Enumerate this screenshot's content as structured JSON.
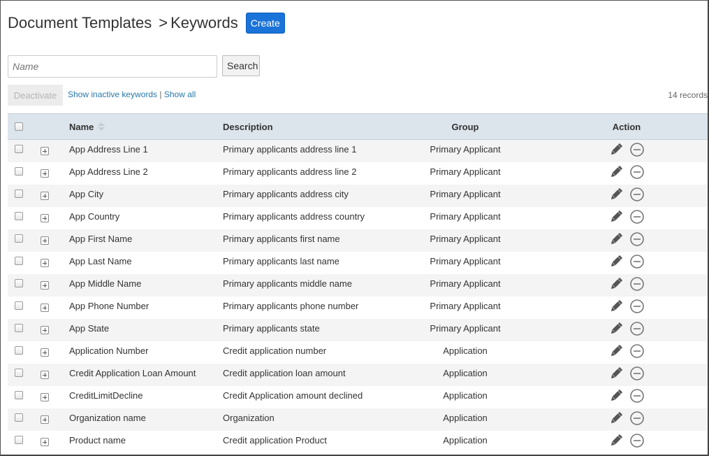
{
  "header": {
    "title": "Document Templates",
    "separator": ">",
    "current": "Keywords",
    "create_label": "Create"
  },
  "search": {
    "placeholder": "Name",
    "value": "",
    "button_label": "Search"
  },
  "toolbar": {
    "deactivate_label": "Deactivate",
    "show_inactive_label": "Show inactive keywords",
    "divider": "|",
    "show_all_label": "Show all",
    "records_count": "14 records"
  },
  "table": {
    "columns": [
      "Name",
      "Description",
      "Group",
      "Action"
    ],
    "sort_icon": "sort-both-icon",
    "row_icons": [
      "expand-plus-icon",
      "pencil-edit-icon",
      "minus-circle-icon"
    ],
    "rows": [
      {
        "name": "App Address Line 1",
        "description": "Primary applicants address line 1",
        "group": "Primary Applicant"
      },
      {
        "name": "App Address Line 2",
        "description": "Primary applicants address line 2",
        "group": "Primary Applicant"
      },
      {
        "name": "App City",
        "description": "Primary applicants address city",
        "group": "Primary Applicant"
      },
      {
        "name": "App Country",
        "description": "Primary applicants address country",
        "group": "Primary Applicant"
      },
      {
        "name": "App First Name",
        "description": "Primary applicants first name",
        "group": "Primary Applicant"
      },
      {
        "name": "App Last Name",
        "description": "Primary applicants last name",
        "group": "Primary Applicant"
      },
      {
        "name": "App Middle Name",
        "description": "Primary applicants middle name",
        "group": "Primary Applicant"
      },
      {
        "name": "App Phone Number",
        "description": "Primary applicants phone number",
        "group": "Primary Applicant"
      },
      {
        "name": "App State",
        "description": "Primary applicants state",
        "group": "Primary Applicant"
      },
      {
        "name": "Application Number",
        "description": "Credit application number",
        "group": "Application"
      },
      {
        "name": "Credit Application Loan Amount",
        "description": "Credit application loan amount",
        "group": "Application"
      },
      {
        "name": "CreditLimitDecline",
        "description": "Credit Application amount declined",
        "group": "Application"
      },
      {
        "name": "Organization name",
        "description": "Organization",
        "group": "Application"
      },
      {
        "name": "Product name",
        "description": "Credit application Product",
        "group": "Application"
      }
    ]
  },
  "colors": {
    "primary_button": "#1a73d9",
    "link": "#2878a8",
    "table_header_bg": "#dce4ec",
    "row_stripe": "#f4f4f4"
  }
}
